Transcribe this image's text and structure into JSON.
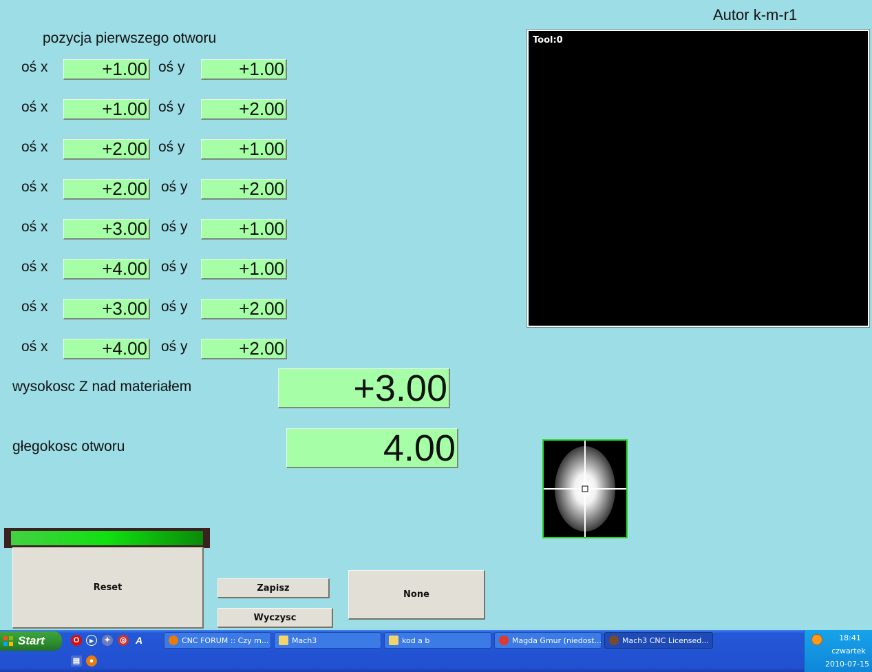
{
  "author": "Autor k-m-r1",
  "section_title": "pozycja pierwszego otworu",
  "axis_labels": {
    "x": "oś x",
    "y": "oś y"
  },
  "rows": [
    {
      "x": "+1.00",
      "y": "+1.00"
    },
    {
      "x": "+1.00",
      "y": "+2.00"
    },
    {
      "x": "+2.00",
      "y": "+1.00"
    },
    {
      "x": "+2.00",
      "y": "+2.00"
    },
    {
      "x": "+3.00",
      "y": "+1.00"
    },
    {
      "x": "+4.00",
      "y": "+1.00"
    },
    {
      "x": "+3.00",
      "y": "+2.00"
    },
    {
      "x": "+4.00",
      "y": "+2.00"
    }
  ],
  "z_height": {
    "label": "wysokosc Z nad materiałem",
    "value": "+3.00"
  },
  "hole_depth": {
    "label": "głegokosc otworu",
    "value": "4.00"
  },
  "toolpath": {
    "tool_label": "Tool:0"
  },
  "buttons": {
    "reset": "Reset",
    "zapisz": "Zapisz",
    "wyczysc": "Wyczysc",
    "none": "None"
  },
  "colors": {
    "background": "#9ddde6",
    "dro": "#a6ffa6",
    "led": "#10e010"
  },
  "taskbar": {
    "start": "Start",
    "tasks": [
      {
        "label": "CNC FORUM :: Czy m...",
        "icon": "firefox-icon"
      },
      {
        "label": "Mach3",
        "icon": "folder-icon"
      },
      {
        "label": "kod a b",
        "icon": "folder-icon"
      },
      {
        "label": "Magda Gmur (niedost...",
        "icon": "gadu-gadu-icon"
      },
      {
        "label": "Mach3 CNC  Licensed...",
        "icon": "mach3-icon",
        "active": true
      }
    ],
    "clock": {
      "time": "18:41",
      "day": "czwartek",
      "date": "2010-07-15"
    }
  }
}
